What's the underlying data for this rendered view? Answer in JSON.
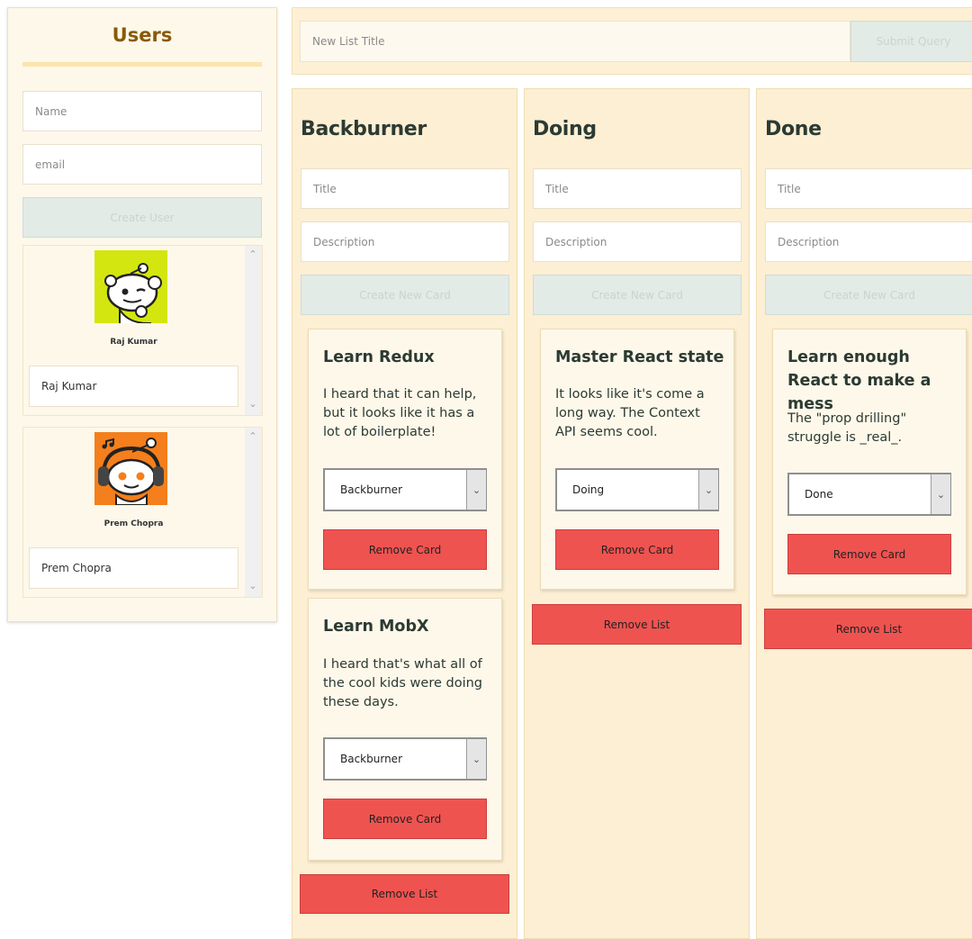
{
  "users": {
    "title": "Users",
    "name_placeholder": "Name",
    "email_placeholder": "email",
    "create_button": "Create User",
    "list": [
      {
        "name": "Raj Kumar",
        "field_value": "Raj Kumar",
        "avatar_color": "#d4e60f"
      },
      {
        "name": "Prem Chopra",
        "field_value": "Prem Chopra",
        "avatar_color": "#f47f1c"
      }
    ]
  },
  "new_list": {
    "placeholder": "New List Title",
    "submit_button": "Submit Query"
  },
  "lists": [
    {
      "title": "Backburner",
      "card_title_placeholder": "Title",
      "card_desc_placeholder": "Description",
      "create_button": "Create New Card",
      "remove_list_button": "Remove List",
      "cards": [
        {
          "title": "Learn Redux",
          "description": "I heard that it can help, but it looks like it has a lot of boilerplate!",
          "status": "Backburner",
          "remove_button": "Remove Card"
        },
        {
          "title": "Learn MobX",
          "description": "I heard that's what all of the cool kids were doing these days.",
          "status": "Backburner",
          "remove_button": "Remove Card"
        }
      ]
    },
    {
      "title": "Doing",
      "card_title_placeholder": "Title",
      "card_desc_placeholder": "Description",
      "create_button": "Create New Card",
      "remove_list_button": "Remove List",
      "cards": [
        {
          "title": "Master React state",
          "description": "It looks like it's come a long way. The Context API seems cool.",
          "status": "Doing",
          "remove_button": "Remove Card"
        }
      ]
    },
    {
      "title": "Done",
      "card_title_placeholder": "Title",
      "card_desc_placeholder": "Description",
      "create_button": "Create New Card",
      "remove_list_button": "Remove List",
      "cards": [
        {
          "title": "Learn enough React to make a mess",
          "description": "The \"prop drilling\" struggle is _real_.",
          "status": "Done",
          "remove_button": "Remove Card"
        }
      ]
    }
  ],
  "colors": {
    "accent_red": "#ef5350",
    "list_bg": "#fdefd3",
    "card_bg": "#fdf8ea",
    "users_title": "#8a5a08"
  }
}
